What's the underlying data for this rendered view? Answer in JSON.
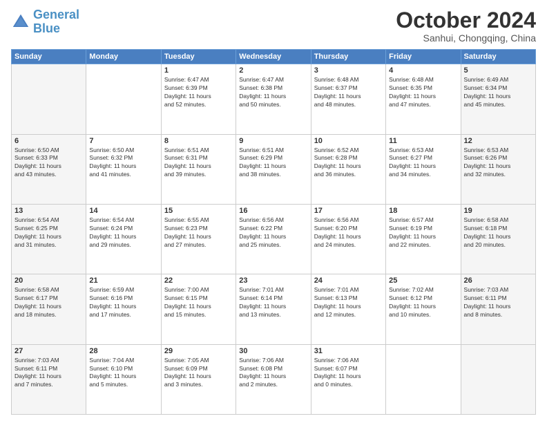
{
  "logo": {
    "line1": "General",
    "line2": "Blue"
  },
  "title": "October 2024",
  "subtitle": "Sanhui, Chongqing, China",
  "days_of_week": [
    "Sunday",
    "Monday",
    "Tuesday",
    "Wednesday",
    "Thursday",
    "Friday",
    "Saturday"
  ],
  "weeks": [
    [
      {
        "day": "",
        "info": ""
      },
      {
        "day": "",
        "info": ""
      },
      {
        "day": "1",
        "info": "Sunrise: 6:47 AM\nSunset: 6:39 PM\nDaylight: 11 hours\nand 52 minutes."
      },
      {
        "day": "2",
        "info": "Sunrise: 6:47 AM\nSunset: 6:38 PM\nDaylight: 11 hours\nand 50 minutes."
      },
      {
        "day": "3",
        "info": "Sunrise: 6:48 AM\nSunset: 6:37 PM\nDaylight: 11 hours\nand 48 minutes."
      },
      {
        "day": "4",
        "info": "Sunrise: 6:48 AM\nSunset: 6:35 PM\nDaylight: 11 hours\nand 47 minutes."
      },
      {
        "day": "5",
        "info": "Sunrise: 6:49 AM\nSunset: 6:34 PM\nDaylight: 11 hours\nand 45 minutes."
      }
    ],
    [
      {
        "day": "6",
        "info": "Sunrise: 6:50 AM\nSunset: 6:33 PM\nDaylight: 11 hours\nand 43 minutes."
      },
      {
        "day": "7",
        "info": "Sunrise: 6:50 AM\nSunset: 6:32 PM\nDaylight: 11 hours\nand 41 minutes."
      },
      {
        "day": "8",
        "info": "Sunrise: 6:51 AM\nSunset: 6:31 PM\nDaylight: 11 hours\nand 39 minutes."
      },
      {
        "day": "9",
        "info": "Sunrise: 6:51 AM\nSunset: 6:29 PM\nDaylight: 11 hours\nand 38 minutes."
      },
      {
        "day": "10",
        "info": "Sunrise: 6:52 AM\nSunset: 6:28 PM\nDaylight: 11 hours\nand 36 minutes."
      },
      {
        "day": "11",
        "info": "Sunrise: 6:53 AM\nSunset: 6:27 PM\nDaylight: 11 hours\nand 34 minutes."
      },
      {
        "day": "12",
        "info": "Sunrise: 6:53 AM\nSunset: 6:26 PM\nDaylight: 11 hours\nand 32 minutes."
      }
    ],
    [
      {
        "day": "13",
        "info": "Sunrise: 6:54 AM\nSunset: 6:25 PM\nDaylight: 11 hours\nand 31 minutes."
      },
      {
        "day": "14",
        "info": "Sunrise: 6:54 AM\nSunset: 6:24 PM\nDaylight: 11 hours\nand 29 minutes."
      },
      {
        "day": "15",
        "info": "Sunrise: 6:55 AM\nSunset: 6:23 PM\nDaylight: 11 hours\nand 27 minutes."
      },
      {
        "day": "16",
        "info": "Sunrise: 6:56 AM\nSunset: 6:22 PM\nDaylight: 11 hours\nand 25 minutes."
      },
      {
        "day": "17",
        "info": "Sunrise: 6:56 AM\nSunset: 6:20 PM\nDaylight: 11 hours\nand 24 minutes."
      },
      {
        "day": "18",
        "info": "Sunrise: 6:57 AM\nSunset: 6:19 PM\nDaylight: 11 hours\nand 22 minutes."
      },
      {
        "day": "19",
        "info": "Sunrise: 6:58 AM\nSunset: 6:18 PM\nDaylight: 11 hours\nand 20 minutes."
      }
    ],
    [
      {
        "day": "20",
        "info": "Sunrise: 6:58 AM\nSunset: 6:17 PM\nDaylight: 11 hours\nand 18 minutes."
      },
      {
        "day": "21",
        "info": "Sunrise: 6:59 AM\nSunset: 6:16 PM\nDaylight: 11 hours\nand 17 minutes."
      },
      {
        "day": "22",
        "info": "Sunrise: 7:00 AM\nSunset: 6:15 PM\nDaylight: 11 hours\nand 15 minutes."
      },
      {
        "day": "23",
        "info": "Sunrise: 7:01 AM\nSunset: 6:14 PM\nDaylight: 11 hours\nand 13 minutes."
      },
      {
        "day": "24",
        "info": "Sunrise: 7:01 AM\nSunset: 6:13 PM\nDaylight: 11 hours\nand 12 minutes."
      },
      {
        "day": "25",
        "info": "Sunrise: 7:02 AM\nSunset: 6:12 PM\nDaylight: 11 hours\nand 10 minutes."
      },
      {
        "day": "26",
        "info": "Sunrise: 7:03 AM\nSunset: 6:11 PM\nDaylight: 11 hours\nand 8 minutes."
      }
    ],
    [
      {
        "day": "27",
        "info": "Sunrise: 7:03 AM\nSunset: 6:11 PM\nDaylight: 11 hours\nand 7 minutes."
      },
      {
        "day": "28",
        "info": "Sunrise: 7:04 AM\nSunset: 6:10 PM\nDaylight: 11 hours\nand 5 minutes."
      },
      {
        "day": "29",
        "info": "Sunrise: 7:05 AM\nSunset: 6:09 PM\nDaylight: 11 hours\nand 3 minutes."
      },
      {
        "day": "30",
        "info": "Sunrise: 7:06 AM\nSunset: 6:08 PM\nDaylight: 11 hours\nand 2 minutes."
      },
      {
        "day": "31",
        "info": "Sunrise: 7:06 AM\nSunset: 6:07 PM\nDaylight: 11 hours\nand 0 minutes."
      },
      {
        "day": "",
        "info": ""
      },
      {
        "day": "",
        "info": ""
      }
    ]
  ]
}
